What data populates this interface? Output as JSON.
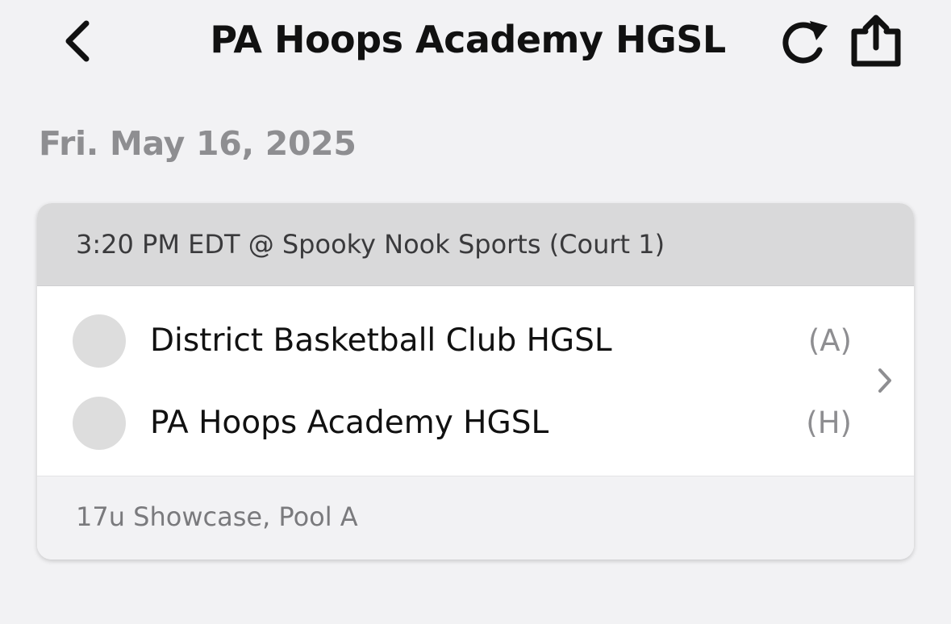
{
  "nav": {
    "title": "PA Hoops Academy HGSL",
    "back_icon": "chevron-left-icon",
    "refresh_icon": "refresh-icon",
    "share_icon": "share-icon"
  },
  "date_heading": "Fri. May 16, 2025",
  "game": {
    "header": "3:20 PM EDT @ Spooky Nook Sports (Court 1)",
    "teams": [
      {
        "name": "District Basketball Club HGSL",
        "side": "(A)"
      },
      {
        "name": "PA Hoops Academy HGSL",
        "side": "(H)"
      }
    ],
    "footer": "17u Showcase, Pool A",
    "chevron_icon": "chevron-right-icon"
  },
  "colors": {
    "background": "#f2f2f4",
    "card_header": "#d9d9da",
    "muted_text": "#8e8e91",
    "logo_placeholder": "#dddddd"
  }
}
